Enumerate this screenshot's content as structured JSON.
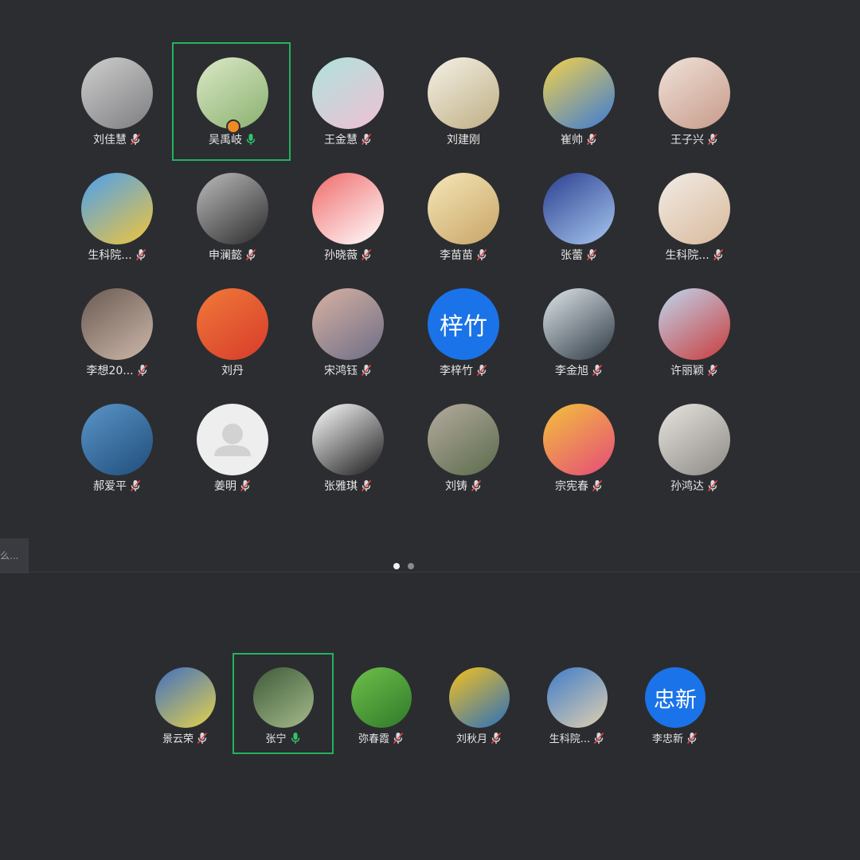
{
  "gallery": {
    "participants": [
      {
        "name": "刘佳慧",
        "mic": "muted",
        "avatar": {
          "kind": "photo",
          "colors": [
            "#cfcfcf",
            "#7d7d80"
          ]
        }
      },
      {
        "name": "吴禹岐",
        "mic": "speaking",
        "host": true,
        "avatar": {
          "kind": "photo",
          "colors": [
            "#dbe9c8",
            "#8ab06e"
          ]
        }
      },
      {
        "name": "王金慧",
        "mic": "muted",
        "avatar": {
          "kind": "photo",
          "colors": [
            "#aee3dd",
            "#f0c0d4"
          ]
        }
      },
      {
        "name": "刘建刚",
        "mic": "none",
        "avatar": {
          "kind": "photo",
          "colors": [
            "#f4f1e6",
            "#bfae84"
          ]
        }
      },
      {
        "name": "崔帅",
        "mic": "muted",
        "avatar": {
          "kind": "photo",
          "colors": [
            "#f4d24a",
            "#3b7bd6"
          ]
        }
      },
      {
        "name": "王子兴",
        "mic": "muted",
        "avatar": {
          "kind": "photo",
          "colors": [
            "#f0e2da",
            "#c69a88"
          ]
        }
      },
      {
        "name": "生科院...",
        "mic": "muted",
        "avatar": {
          "kind": "photo",
          "colors": [
            "#4aa0f0",
            "#f2c53a"
          ]
        }
      },
      {
        "name": "申澜懿",
        "mic": "muted",
        "avatar": {
          "kind": "photo",
          "colors": [
            "#bcbcbc",
            "#2b2b2b"
          ]
        }
      },
      {
        "name": "孙晓薇",
        "mic": "muted",
        "avatar": {
          "kind": "photo",
          "colors": [
            "#f06a6a",
            "#ffffff"
          ]
        }
      },
      {
        "name": "李苗苗",
        "mic": "muted",
        "avatar": {
          "kind": "photo",
          "colors": [
            "#f5e7b8",
            "#c8a466"
          ]
        }
      },
      {
        "name": "张蕾",
        "mic": "muted",
        "avatar": {
          "kind": "photo",
          "colors": [
            "#2a3f8f",
            "#a7c7f0"
          ]
        }
      },
      {
        "name": "生科院...",
        "mic": "muted",
        "avatar": {
          "kind": "photo",
          "colors": [
            "#f2ece6",
            "#d8b99b"
          ]
        }
      },
      {
        "name": "李想20...",
        "mic": "muted",
        "avatar": {
          "kind": "photo",
          "colors": [
            "#6a5a52",
            "#cdb8aa"
          ]
        }
      },
      {
        "name": "刘丹",
        "mic": "none",
        "avatar": {
          "kind": "photo",
          "colors": [
            "#f07a3a",
            "#d73b2a"
          ]
        }
      },
      {
        "name": "宋鸿钰",
        "mic": "muted",
        "avatar": {
          "kind": "photo",
          "colors": [
            "#d9b2a3",
            "#6c6d86"
          ]
        }
      },
      {
        "name": "李梓竹",
        "mic": "muted",
        "avatar": {
          "kind": "text",
          "text": "梓竹",
          "colors": [
            "#1a73e8",
            "#1a73e8"
          ]
        }
      },
      {
        "name": "李金旭",
        "mic": "muted",
        "avatar": {
          "kind": "photo",
          "colors": [
            "#dfe5ea",
            "#2e3a44"
          ]
        }
      },
      {
        "name": "许丽颖",
        "mic": "muted",
        "avatar": {
          "kind": "photo",
          "colors": [
            "#bfd7ef",
            "#c93b3b"
          ]
        }
      },
      {
        "name": "郝爱平",
        "mic": "muted",
        "avatar": {
          "kind": "photo",
          "colors": [
            "#5b95c9",
            "#1f4d7a"
          ]
        }
      },
      {
        "name": "姜明",
        "mic": "muted",
        "avatar": {
          "kind": "placeholder",
          "colors": [
            "#eeeeee",
            "#d2d2d2"
          ]
        }
      },
      {
        "name": "张雅琪",
        "mic": "muted",
        "avatar": {
          "kind": "photo",
          "colors": [
            "#ffffff",
            "#1a1a1a"
          ]
        }
      },
      {
        "name": "刘铸",
        "mic": "muted",
        "avatar": {
          "kind": "photo",
          "colors": [
            "#b5ab9f",
            "#5a6b4b"
          ]
        }
      },
      {
        "name": "宗宪春",
        "mic": "muted",
        "avatar": {
          "kind": "photo",
          "colors": [
            "#f3c23c",
            "#e54a7a"
          ]
        }
      },
      {
        "name": "孙鸿达",
        "mic": "muted",
        "avatar": {
          "kind": "photo",
          "colors": [
            "#e7e4df",
            "#8d8a86"
          ]
        }
      }
    ]
  },
  "pagination": {
    "pages": 2,
    "current": 1
  },
  "side_tab": {
    "label": "么..."
  },
  "strip": {
    "participants": [
      {
        "name": "景云荣",
        "mic": "muted",
        "avatar": {
          "kind": "photo",
          "colors": [
            "#3f6fc2",
            "#e6d24a"
          ]
        }
      },
      {
        "name": "张宁",
        "mic": "speaking",
        "avatar": {
          "kind": "photo",
          "colors": [
            "#3e5a3a",
            "#a4bb8a"
          ]
        }
      },
      {
        "name": "弥春霞",
        "mic": "muted",
        "avatar": {
          "kind": "photo",
          "colors": [
            "#6fbf4a",
            "#2f7a2a"
          ]
        }
      },
      {
        "name": "刘秋月",
        "mic": "muted",
        "avatar": {
          "kind": "photo",
          "colors": [
            "#f5c21e",
            "#2a6fbd"
          ]
        }
      },
      {
        "name": "生科院...",
        "mic": "muted",
        "avatar": {
          "kind": "photo",
          "colors": [
            "#3e7cc9",
            "#e0d0b0"
          ]
        }
      },
      {
        "name": "李忠新",
        "mic": "muted",
        "avatar": {
          "kind": "text",
          "text": "忠新",
          "colors": [
            "#1a73e8",
            "#1a73e8"
          ]
        }
      }
    ]
  }
}
